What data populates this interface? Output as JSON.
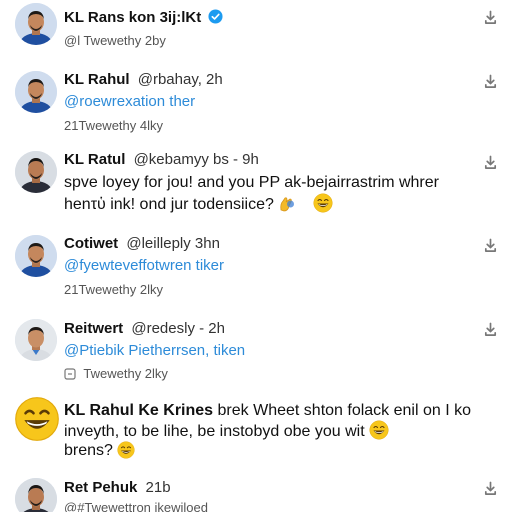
{
  "tweets": [
    {
      "name": "KL Rans kon 3ij:lKt",
      "meta": "@l Twewethy 2by"
    },
    {
      "name": "KL Rahul",
      "handle": "@rbahay, 2h",
      "link": "@roewrexation ther",
      "meta": "21Twewethy 4lky"
    },
    {
      "name": "KL Ratul",
      "handle": "@kebamyy bs - 9h",
      "line1": "spve loyey for jou! and you PP ak-bejairrastrim whrer",
      "line2": "henτὑ ink! ond jur todensiice?"
    },
    {
      "name": "Cotiwet",
      "handle": "@leilleply 3hn",
      "link": "@fyewteveffotwren tiker",
      "meta": "21Twewethy 2lky"
    },
    {
      "name": "Reitwert",
      "handle": "@redesly - 2h",
      "link": "@Ptiebik Pietherrsen, tiken",
      "meta": "Twewethy 2lky"
    },
    {
      "name": "KL Rahul Ke Krines",
      "line1": "brek Wheet shton folack enil on I ko",
      "line2": "inveyth, to be lihe, be instobyd obe you wit",
      "line3": "brens?"
    },
    {
      "name": "Ret Pehuk",
      "handle": "21b",
      "meta": "@#Twewettron ikewiloed"
    }
  ],
  "icons": {
    "action": "share-icon",
    "verified": "verified-badge-icon",
    "emoji": "grinning-face-emoji"
  },
  "colors": {
    "link": "#2d8bd8",
    "verified": "#1d9bf0",
    "emoji": "#f7c61b"
  }
}
